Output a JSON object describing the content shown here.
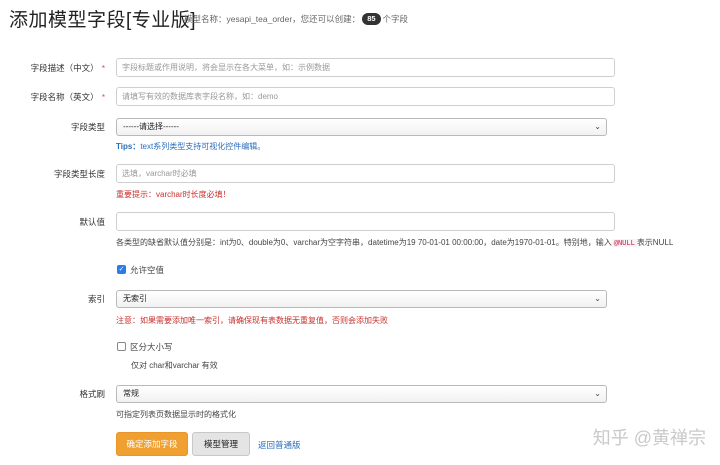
{
  "header": {
    "title": "添加模型字段[专业版]",
    "model_info_prefix": "模型名称：yesapi_tea_order，您还可以创建：",
    "remaining_count": "85",
    "model_info_suffix": "个字段"
  },
  "form": {
    "field_desc": {
      "label": "字段描述（中文）",
      "required_mark": "*",
      "placeholder": "字段标题或作用说明，将会显示在各大菜单，如：示例数据"
    },
    "field_name": {
      "label": "字段名称（英文）",
      "required_mark": "*",
      "placeholder": "请填写有效的数据库表字段名称，如：demo"
    },
    "field_type": {
      "label": "字段类型",
      "selected": "------请选择------",
      "tips_prefix": "Tips：",
      "tips_text": "text系列类型支持可视化控件编辑。"
    },
    "field_length": {
      "label": "字段类型长度",
      "placeholder": "选填，varchar时必填",
      "warning": "重要提示：varchar时长度必填！"
    },
    "default_value": {
      "label": "默认值",
      "value": "",
      "help_before": "各类型的缺省默认值分别是：int为0、double为0、varchar为空字符串，datetime为19 70-01-01 00:00:00，date为1970-01-01。特别地，输入",
      "help_code": "@NULL",
      "help_after": "表示NULL"
    },
    "allow_null": {
      "label": "允许空值",
      "checked": true
    },
    "index": {
      "label": "索引",
      "selected": "无索引",
      "warning": "注意：如果需要添加唯一索引，请确保现有表数据无重复值，否则会添加失败"
    },
    "case_sensitive": {
      "label": "区分大小写",
      "checked": false,
      "help": "仅对 char和varchar 有效"
    },
    "formatter": {
      "label": "格式刷",
      "selected": "常规",
      "help": "可指定列表页数据显示时的格式化"
    }
  },
  "actions": {
    "submit_label": "确定添加字段",
    "manage_label": "模型管理",
    "back_label": "返回普通版"
  },
  "watermark": "知乎 @黄禅宗",
  "colors": {
    "primary": "#f0a030",
    "link": "#2a6ebb",
    "danger": "#c9302c",
    "check": "#2f7be5"
  }
}
